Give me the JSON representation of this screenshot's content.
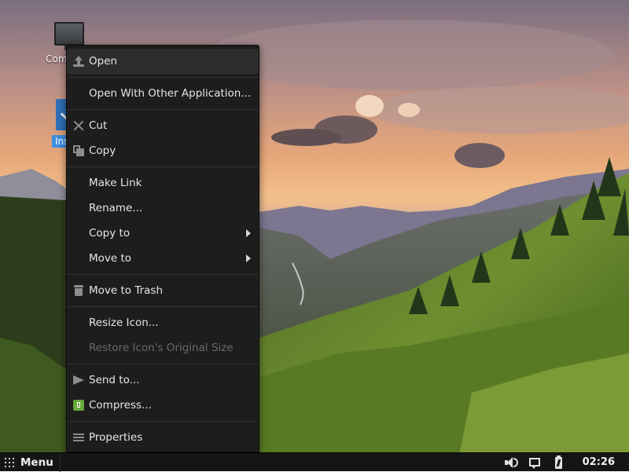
{
  "desktop": {
    "icons": [
      {
        "label": "Computer",
        "icon": "monitor-icon",
        "selected": false
      },
      {
        "label": "Install",
        "icon": "install-icon",
        "selected": true
      }
    ]
  },
  "context_menu": {
    "items": [
      {
        "label": "Open",
        "icon": "open-icon",
        "active": true
      },
      {
        "label": "Open With Other Application...",
        "icon": ""
      },
      {
        "label": "Cut",
        "icon": "cut-icon"
      },
      {
        "label": "Copy",
        "icon": "copy-icon"
      },
      {
        "label": "Make Link",
        "icon": ""
      },
      {
        "label": "Rename...",
        "icon": ""
      },
      {
        "label": "Copy to",
        "icon": "",
        "submenu": true
      },
      {
        "label": "Move to",
        "icon": "",
        "submenu": true
      },
      {
        "label": "Move to Trash",
        "icon": "trash-icon"
      },
      {
        "label": "Resize Icon...",
        "icon": ""
      },
      {
        "label": "Restore Icon's Original Size",
        "icon": "",
        "disabled": true
      },
      {
        "label": "Send to...",
        "icon": "send-icon"
      },
      {
        "label": "Compress...",
        "icon": "compress-icon"
      },
      {
        "label": "Properties",
        "icon": "properties-icon"
      }
    ]
  },
  "panel": {
    "menu_label": "Menu",
    "tray": [
      "volume-icon",
      "notifications-icon",
      "battery-icon"
    ],
    "clock": "02:26"
  },
  "colors": {
    "menu_bg": "#1d1d1d",
    "selection": "#3d8ee0",
    "panel_bg": "#151515"
  }
}
